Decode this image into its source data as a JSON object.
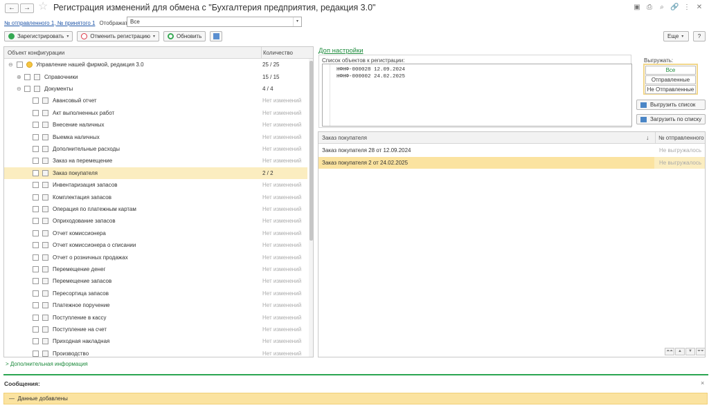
{
  "window": {
    "title": "Регистрация изменений для обмена с  \"Бухгалтерия предприятия, редакция 3.0\"",
    "back_icon": "←",
    "forward_icon": "→",
    "star_icon": "☆",
    "icons": [
      "save-icon",
      "print-icon",
      "preview-icon",
      "link-icon",
      "more-icon",
      "close-icon"
    ],
    "icon_glyphs": [
      "▣",
      "⎙",
      "⌕",
      "🔗",
      "⋮",
      "✕"
    ]
  },
  "header": {
    "sent_link": "№ отправленного 1, № принятого 1",
    "show_label": "Отображать:",
    "show_value": "Все",
    "dropdown_glyph": "▾"
  },
  "toolbar": {
    "register": "Зарегистрировать",
    "cancel_registration": "Отменить регистрацию",
    "refresh": "Обновить",
    "more": "Еще",
    "help": "?",
    "arrow": "▾"
  },
  "tree": {
    "col_object": "Объект конфигурации",
    "col_count": "Количество",
    "rows": [
      {
        "name": "Управление нашей фирмой, редакция 3.0",
        "count": "25 / 25",
        "level": 0,
        "toggle": "⊖",
        "muted": false
      },
      {
        "name": "Справочники",
        "count": "15 / 15",
        "level": 1,
        "toggle": "⊕",
        "muted": false
      },
      {
        "name": "Документы",
        "count": "4 / 4",
        "level": 1,
        "toggle": "⊖",
        "muted": false
      },
      {
        "name": "Авансовый отчет",
        "count": "Нет изменений",
        "level": 2,
        "muted": true
      },
      {
        "name": "Акт выполненных работ",
        "count": "Нет изменений",
        "level": 2,
        "muted": true
      },
      {
        "name": "Внесение наличных",
        "count": "Нет изменений",
        "level": 2,
        "muted": true
      },
      {
        "name": "Выемка наличных",
        "count": "Нет изменений",
        "level": 2,
        "muted": true
      },
      {
        "name": "Дополнительные расходы",
        "count": "Нет изменений",
        "level": 2,
        "muted": true
      },
      {
        "name": "Заказ на перемещение",
        "count": "Нет изменений",
        "level": 2,
        "muted": true
      },
      {
        "name": "Заказ покупателя",
        "count": "2 / 2",
        "level": 2,
        "muted": false,
        "selected": true
      },
      {
        "name": "Инвентаризация запасов",
        "count": "Нет изменений",
        "level": 2,
        "muted": true
      },
      {
        "name": "Комплектация запасов",
        "count": "Нет изменений",
        "level": 2,
        "muted": true
      },
      {
        "name": "Операция по платежным картам",
        "count": "Нет изменений",
        "level": 2,
        "muted": true
      },
      {
        "name": "Оприходование запасов",
        "count": "Нет изменений",
        "level": 2,
        "muted": true
      },
      {
        "name": "Отчет комиссионера",
        "count": "Нет изменений",
        "level": 2,
        "muted": true
      },
      {
        "name": "Отчет комиссионера о списании",
        "count": "Нет изменений",
        "level": 2,
        "muted": true
      },
      {
        "name": "Отчет о розничных продажах",
        "count": "Нет изменений",
        "level": 2,
        "muted": true
      },
      {
        "name": "Перемещение денег",
        "count": "Нет изменений",
        "level": 2,
        "muted": true
      },
      {
        "name": "Перемещение запасов",
        "count": "Нет изменений",
        "level": 2,
        "muted": true
      },
      {
        "name": "Пересортица запасов",
        "count": "Нет изменений",
        "level": 2,
        "muted": true
      },
      {
        "name": "Платежное поручение",
        "count": "Нет изменений",
        "level": 2,
        "muted": true
      },
      {
        "name": "Поступление в кассу",
        "count": "Нет изменений",
        "level": 2,
        "muted": true
      },
      {
        "name": "Поступление на счет",
        "count": "Нет изменений",
        "level": 2,
        "muted": true
      },
      {
        "name": "Приходная накладная",
        "count": "Нет изменений",
        "level": 2,
        "muted": true
      },
      {
        "name": "Производство",
        "count": "Нет изменений",
        "level": 2,
        "muted": true
      }
    ]
  },
  "settings": {
    "dop_link": "Доп настройки",
    "reg_list_label": "Список объектов к регистрации:",
    "reg_lines": [
      "НФНФ-000028 12.09.2024",
      "НФНФ-000002 24.02.2025"
    ],
    "export_label": "Выгружать:",
    "export_options": [
      "Все",
      "Отправленные",
      "Не Отправленные"
    ],
    "export_selected": "Все",
    "upload_list": "Выгрузить список",
    "load_by_list": "Загрузить по списку"
  },
  "orders": {
    "col_order": "Заказ покупателя",
    "col_sent": "№ отправленного",
    "sort_glyph": "↓",
    "rows": [
      {
        "order": "Заказ покупателя 28 от 12.09.2024",
        "sent": "Не выгружалось",
        "selected": false
      },
      {
        "order": "Заказ покупателя 2 от 24.02.2025",
        "sent": "Не выгружалось",
        "selected": true
      }
    ],
    "nav_glyphs": [
      "⏶⏶",
      "▲",
      "▼",
      "⏷⏷"
    ]
  },
  "footer": {
    "additional_info": "Дополнительная информация",
    "messages_title": "Сообщения:",
    "close": "×",
    "message": "Данные добавлены"
  },
  "colors": {
    "accent_green": "#2aa550",
    "selection": "#fbedc0",
    "link_blue": "#1e55a8"
  }
}
